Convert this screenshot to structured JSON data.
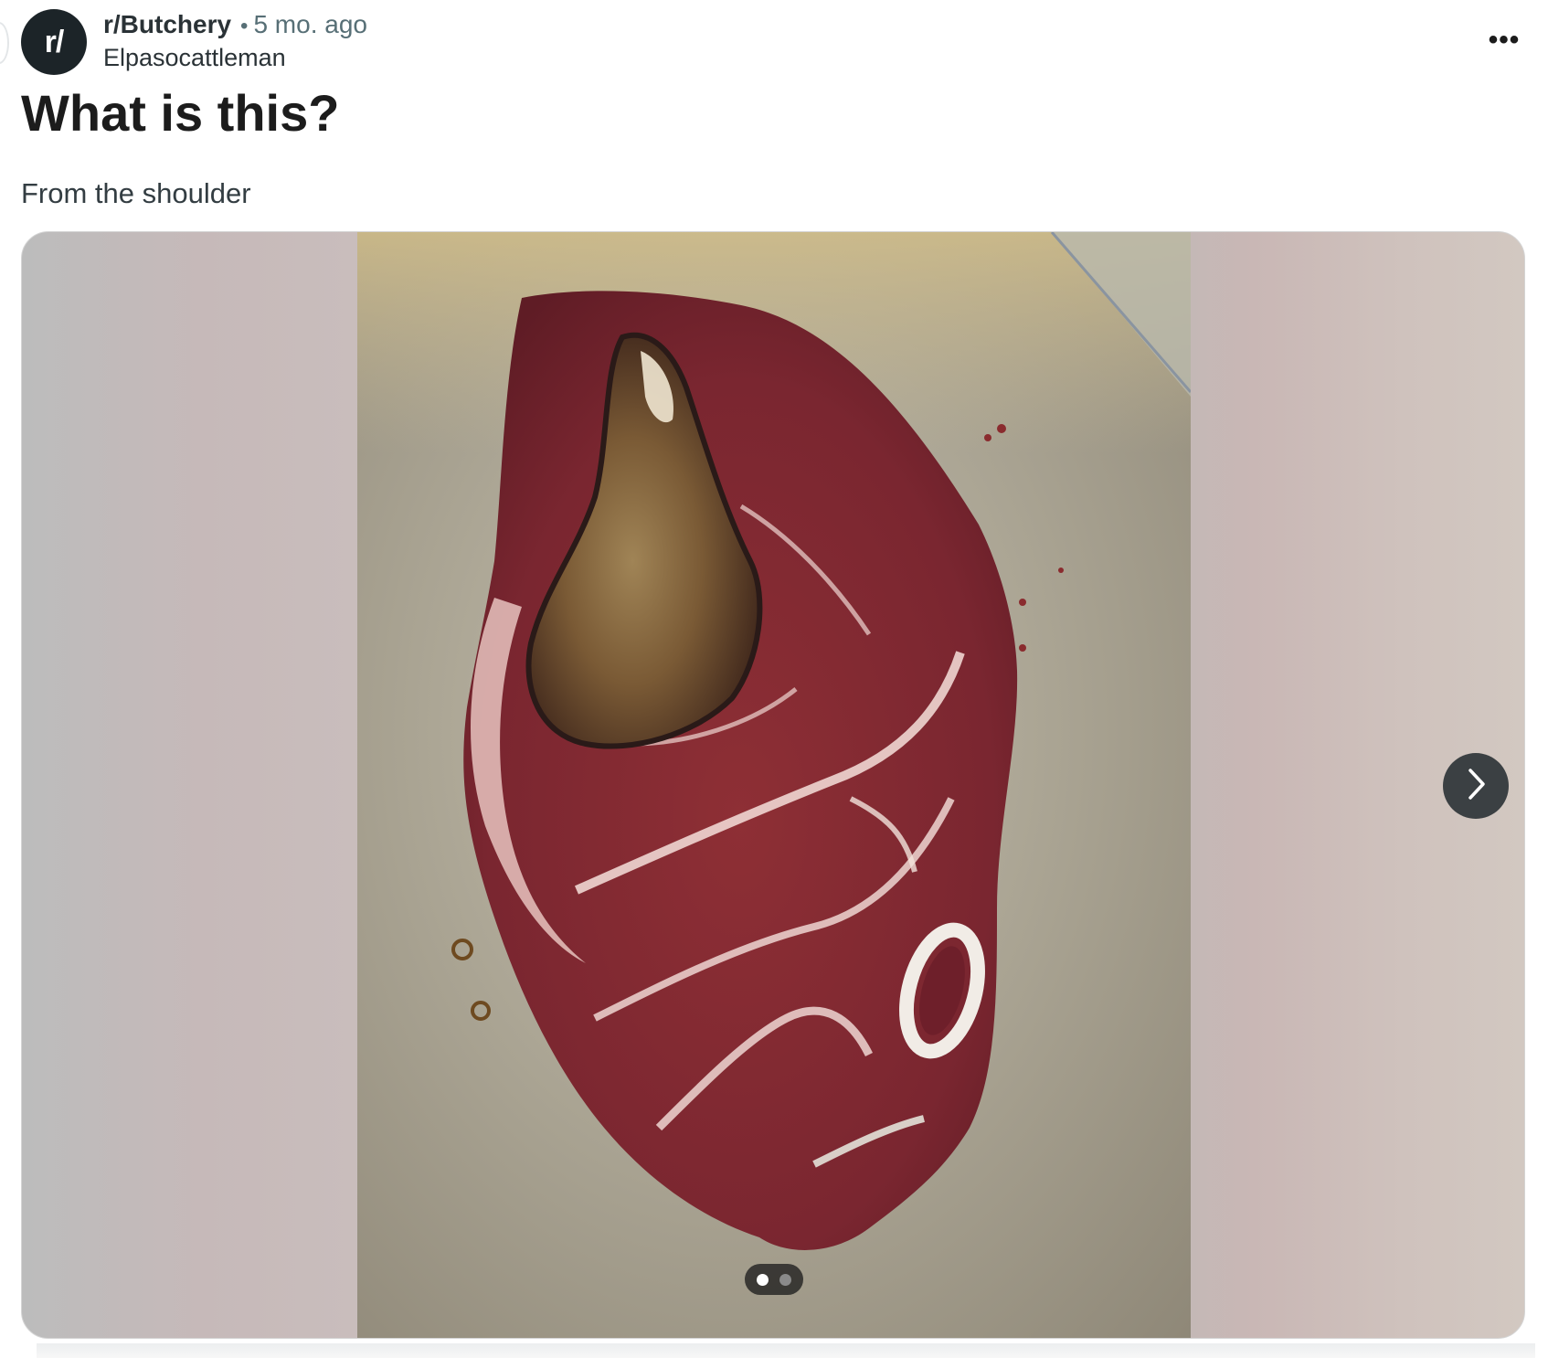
{
  "post": {
    "avatar_text": "r/",
    "subreddit": "r/Butchery",
    "separator": "•",
    "time_ago": "5 mo. ago",
    "author": "Elpasocattleman",
    "overflow_label": "•••",
    "title": "What is this?",
    "body": "From the shoulder"
  },
  "gallery": {
    "total_images": 2,
    "current_index": 1,
    "next_icon": "chevron-right-icon"
  },
  "colors": {
    "avatar_bg": "#1c2428",
    "meta_grey": "#576f76",
    "nav_button_bg": "#3b4043"
  }
}
